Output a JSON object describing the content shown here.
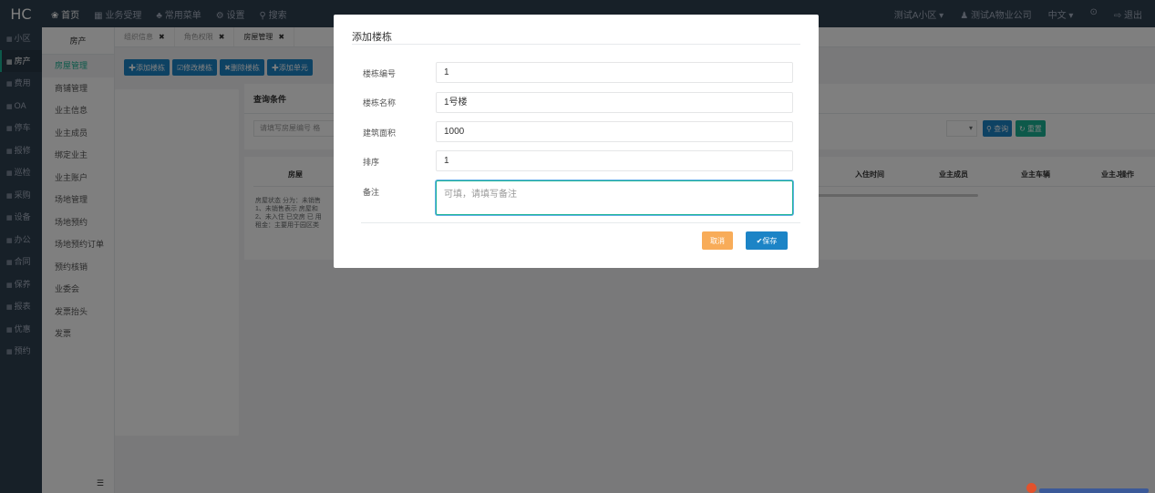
{
  "topbar": {
    "logo": "HC",
    "nav": [
      "❀ 首页",
      "▦ 业务受理",
      "♣ 常用菜单",
      "⚙ 设置",
      "⚲ 搜索"
    ],
    "right": [
      "测试A小区 ▾",
      "♟ 测试A物业公司",
      "中文 ▾",
      "⊙",
      "⇨ 退出"
    ]
  },
  "icon_sidebar": [
    "小区",
    "房产",
    "费用",
    "OA",
    "停车",
    "报修",
    "巡检",
    "采购",
    "设备",
    "办公",
    "合同",
    "保养",
    "报表",
    "优惠",
    "预约"
  ],
  "sub_sidebar": {
    "head": "房产",
    "items": [
      "房屋管理",
      "商铺管理",
      "业主信息",
      "业主成员",
      "绑定业主",
      "业主账户",
      "场地管理",
      "场地预约",
      "场地预约订单",
      "预约核销",
      "业委会",
      "发票抬头",
      "发票"
    ],
    "bottom": "☰"
  },
  "tabs": [
    {
      "label": "组织信息",
      "close": "✖"
    },
    {
      "label": "角色权限",
      "close": "✖"
    },
    {
      "label": "房屋管理",
      "close": "✖"
    }
  ],
  "content": {
    "buttons": [
      "✚添加楼栋",
      "☑修改楼栋",
      "✖删除楼栋",
      "✚添加单元"
    ],
    "query_title": "查询条件",
    "query_placeholder": "请填写房屋编号  格",
    "query_select": "▾",
    "search_label": "⚲ 查询",
    "reset_label": "↻ 重置",
    "table_headers": [
      "房屋",
      "入住时间",
      "业主成员",
      "业主车辆",
      "业主J",
      "操作"
    ],
    "note": "房屋状态 分为：未销售 1、未销售表示 房屋和 2、未入住 已交房 已 用 租金：主要用于园区类"
  },
  "modal": {
    "title": "添加楼栋",
    "fields": [
      {
        "label": "楼栋编号",
        "value": "1"
      },
      {
        "label": "楼栋名称",
        "value": "1号楼"
      },
      {
        "label": "建筑面积",
        "value": "1000"
      },
      {
        "label": "排序",
        "value": "1"
      }
    ],
    "remark_label": "备注",
    "remark_placeholder": "可填，请填写备注",
    "cancel": "取消",
    "save": "✔保存"
  }
}
